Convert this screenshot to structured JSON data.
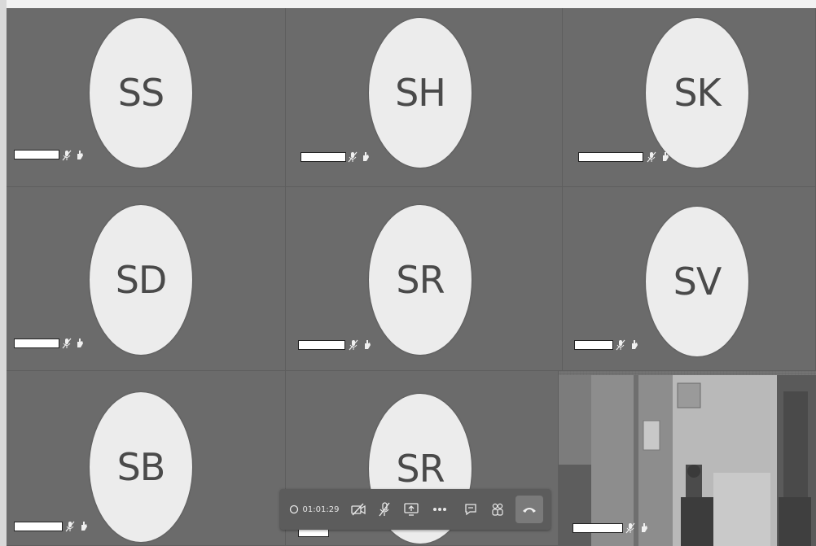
{
  "participants": [
    {
      "initials": "SS"
    },
    {
      "initials": "SH"
    },
    {
      "initials": "SK"
    },
    {
      "initials": "SD"
    },
    {
      "initials": "SR"
    },
    {
      "initials": "SV"
    },
    {
      "initials": "SB"
    },
    {
      "initials": "SR"
    }
  ],
  "call_controls": {
    "timer": "01:01:29",
    "icons": [
      "record-indicator-icon",
      "camera-off-icon",
      "mic-off-icon",
      "share-screen-icon",
      "more-options-icon",
      "chat-icon",
      "participants-icon",
      "hang-up-icon"
    ]
  }
}
